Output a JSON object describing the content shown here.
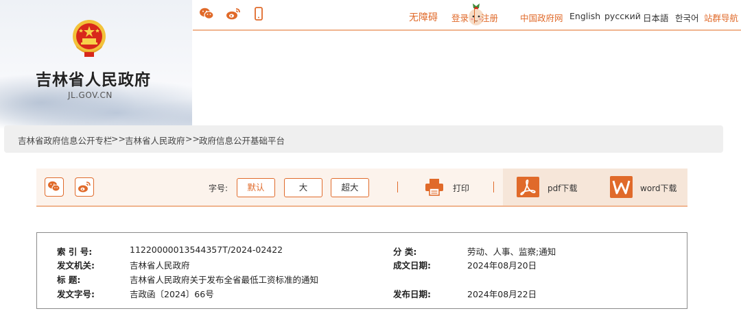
{
  "site": {
    "title": "吉林省人民政府",
    "domain": "JL.GOV.CN"
  },
  "topbar": {
    "accessibility": "无障碍",
    "login": "登录",
    "register": "注册",
    "gov_portal": "中国政府网",
    "lang_en": "English",
    "lang_ru": "русский",
    "lang_ja": "日本語",
    "lang_ko": "한국어",
    "site_nav": "站群导航",
    "icons": [
      "wechat-icon",
      "weibo-icon",
      "mobile-icon",
      "mascot-icon"
    ]
  },
  "breadcrumb": {
    "items": [
      "吉林省政府信息公开专栏",
      "吉林省人民政府",
      "政府信息公开基础平台"
    ],
    "separator": ">>"
  },
  "toolbar": {
    "font_label": "字号:",
    "size_default": "默认",
    "size_large": "大",
    "size_xlarge": "超大",
    "print": "打印",
    "pdf": "pdf下载",
    "word": "word下载"
  },
  "info": {
    "index_key": "索 引 号:",
    "index_val": "11220000013544357T/2024-02422",
    "category_key": "分 类:",
    "category_val": "劳动、人事、监察;通知",
    "issuer_key": "发文机关:",
    "issuer_val": "吉林省人民政府",
    "date_key": "成文日期:",
    "date_val": "2024年08月20日",
    "title_key": "标 题:",
    "title_val": "吉林省人民政府关于发布全省最低工资标准的通知",
    "docno_key": "发文字号:",
    "docno_val": "吉政函〔2024〕66号",
    "pubdate_key": "发布日期:",
    "pubdate_val": "2024年08月22日"
  },
  "colors": {
    "accent": "#e06a2a",
    "accent_light": "#f0b48e",
    "toolbar_bg": "#fcf3ec"
  }
}
